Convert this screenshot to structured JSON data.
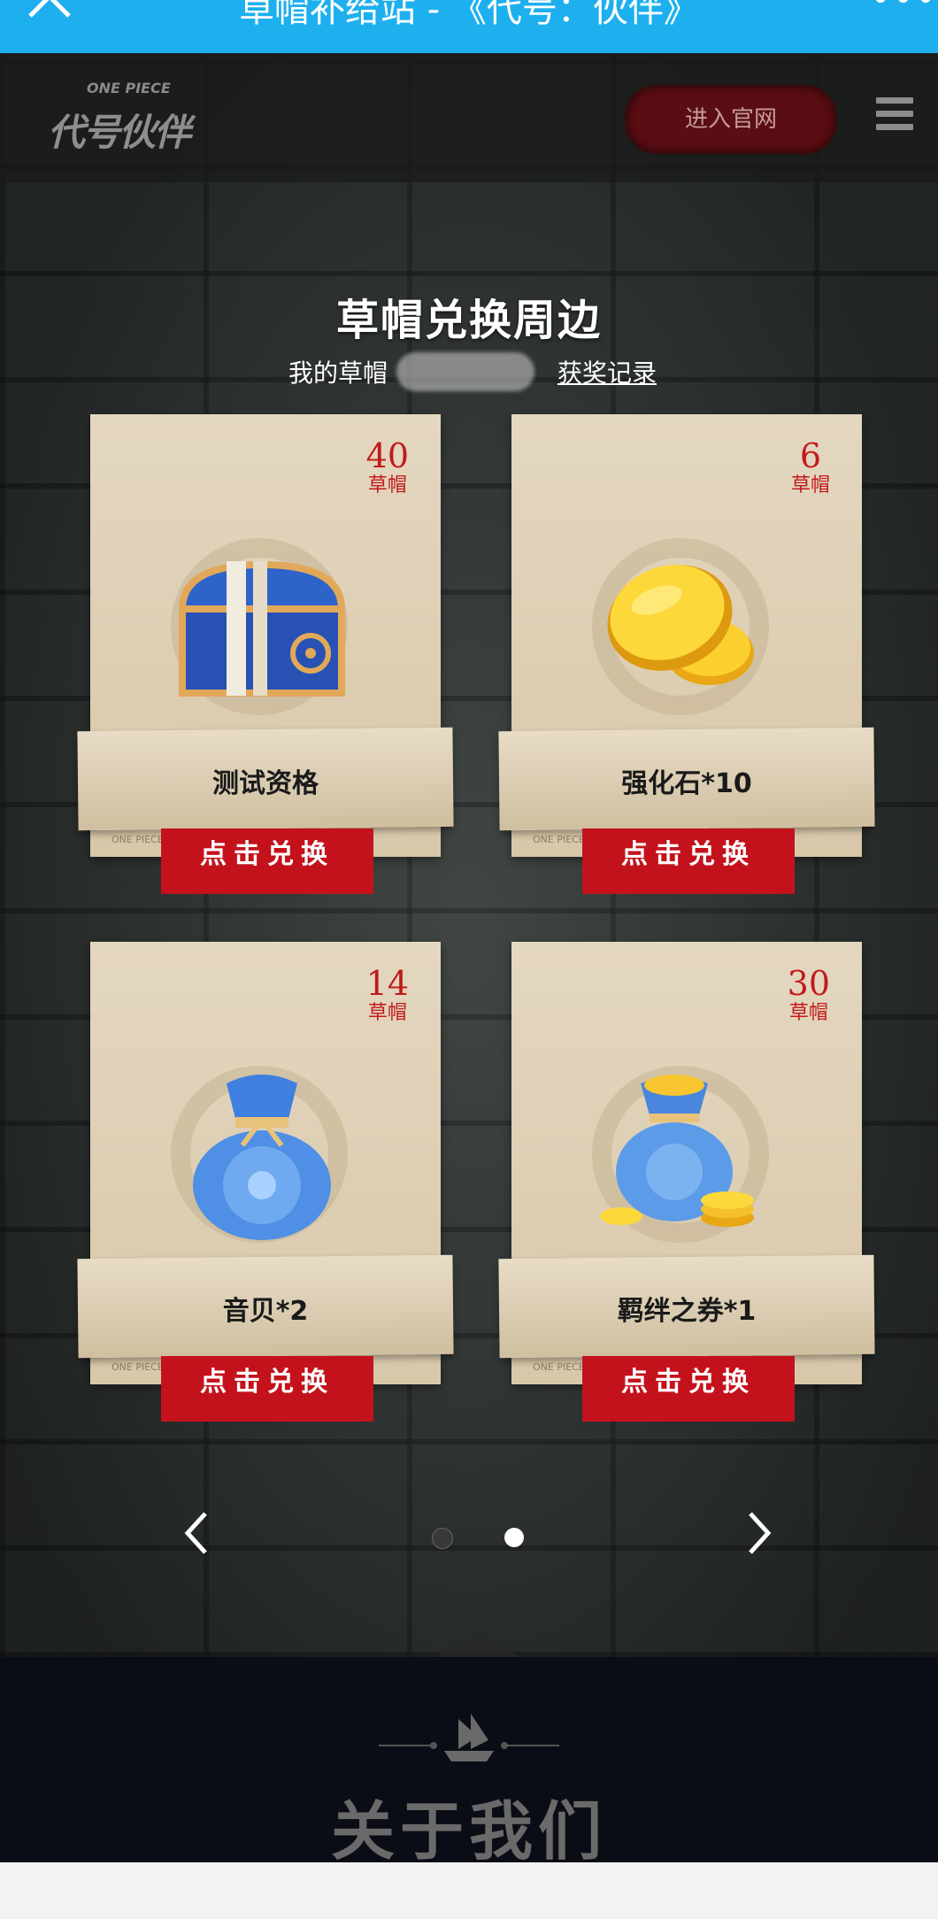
{
  "topbar": {
    "title": "草帽补给站 - 《代号：伙伴》",
    "more": "•••"
  },
  "header": {
    "logo_small": "ONE PIECE",
    "logo_big": "代号伙伴",
    "enter_label": "进入官网"
  },
  "section": {
    "title": "草帽兑换周边",
    "my_hats_label": "我的草帽",
    "record_label": "获奖记录"
  },
  "cards": [
    {
      "price": "40",
      "unit": "草帽",
      "name": "测试资格",
      "redeem": "点击兑换",
      "tag": "ONE PIECE",
      "icon": "treasure-chest"
    },
    {
      "price": "6",
      "unit": "草帽",
      "name": "强化石*10",
      "redeem": "点击兑换",
      "tag": "ONE PIECE",
      "icon": "gold-coins"
    },
    {
      "price": "14",
      "unit": "草帽",
      "name": "音贝*2",
      "redeem": "点击兑换",
      "tag": "ONE PIECE",
      "icon": "blue-bag"
    },
    {
      "price": "30",
      "unit": "草帽",
      "name": "羁绊之券*1",
      "redeem": "点击兑换",
      "tag": "ONE PIECE",
      "icon": "coin-bag"
    }
  ],
  "pager": {
    "total": 2,
    "active": 2
  },
  "footer": {
    "about": "关于我们"
  },
  "colors": {
    "topbar": "#1eb0ee",
    "redeem": "#c4121c",
    "price": "#c11a1a"
  }
}
